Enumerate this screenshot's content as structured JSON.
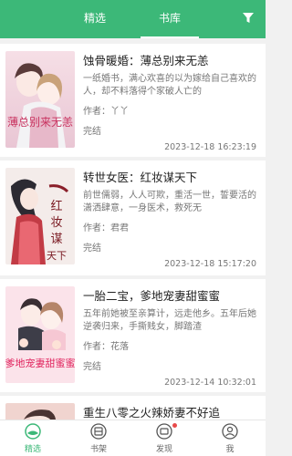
{
  "colors": {
    "accent": "#3cb878",
    "badge": "#e84a4a"
  },
  "header": {
    "tabs": [
      {
        "label": "精选",
        "active": false
      },
      {
        "label": "书库",
        "active": true
      }
    ],
    "filter_icon": "filter-funnel-icon"
  },
  "books": [
    {
      "title": "蚀骨暖婚：薄总别来无恙",
      "desc": "一纸婚书，满心欢喜的以为嫁给自己喜欢的人，却不料落得个家破人亡的",
      "author": "作者：丫丫",
      "status": "完结",
      "date": "2023-12-18 16:23:19",
      "cover_text": "薄总别来无恙"
    },
    {
      "title": "转世女医：红妆谋天下",
      "desc": "前世儒弱，人人可欺，重活一世，誓要活的潇洒肆意，一身医术，救死无",
      "author": "作者：君君",
      "status": "完结",
      "date": "2023-12-18 15:17:20",
      "cover_text": "红妆谋天下"
    },
    {
      "title": "一胎二宝，爹地宠妻甜蜜蜜",
      "desc": "五年前她被至亲算计，远走他乡。五年后她逆袭归来，手撕贱女，脚踏渣",
      "author": "作者：花落",
      "status": "完结",
      "date": "2023-12-14 10:32:01",
      "cover_text": "爹地宠妻甜蜜蜜"
    },
    {
      "title": "重生八零之火辣娇妻不好追",
      "desc": "",
      "author": "",
      "status": "",
      "date": "",
      "cover_text": ""
    }
  ],
  "bottom_nav": [
    {
      "label": "精选",
      "icon": "featured-icon",
      "active": true
    },
    {
      "label": "书架",
      "icon": "bookshelf-icon",
      "active": false
    },
    {
      "label": "发现",
      "icon": "discover-icon",
      "active": false,
      "badge": true
    },
    {
      "label": "我",
      "icon": "profile-icon",
      "active": false
    }
  ]
}
